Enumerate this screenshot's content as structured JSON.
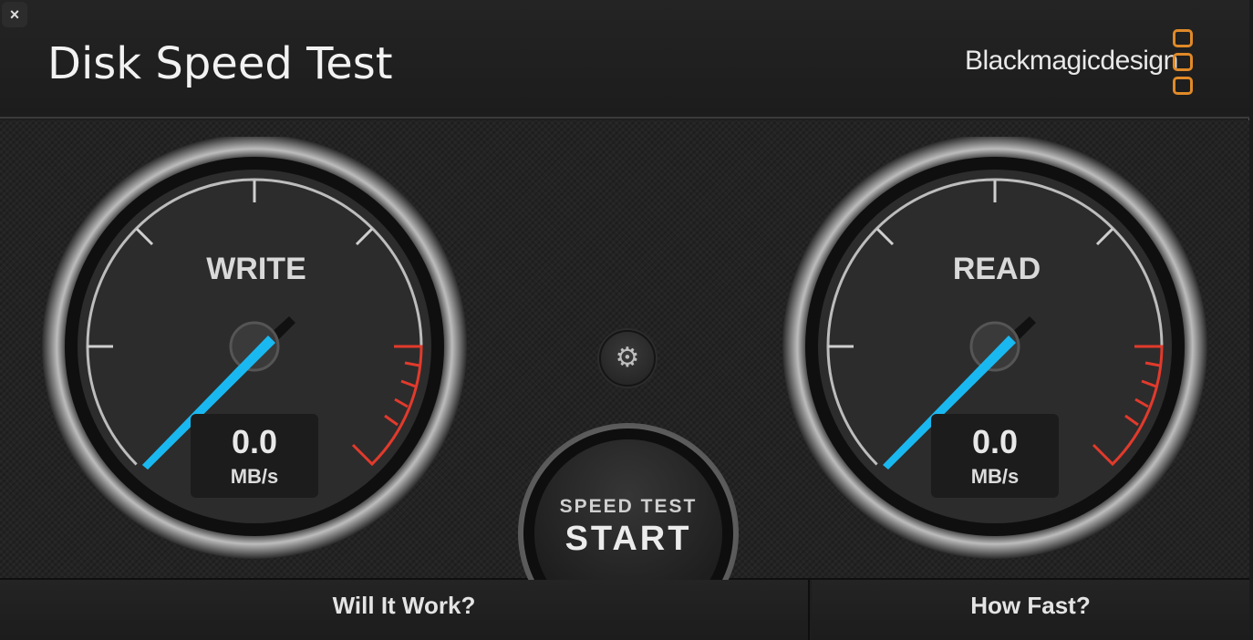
{
  "window": {
    "title": "Disk Speed Test",
    "close_label": "×",
    "brand_name": "Blackmagicdesign"
  },
  "gauges": {
    "write": {
      "label": "WRITE",
      "value": "0.0",
      "unit": "MB/s",
      "needle_color": "#1ab8f0",
      "redline_color": "#e23a2c"
    },
    "read": {
      "label": "READ",
      "value": "0.0",
      "unit": "MB/s",
      "needle_color": "#1ab8f0",
      "redline_color": "#e23a2c"
    }
  },
  "controls": {
    "settings_icon": "gear-icon",
    "start_top_label": "SPEED TEST",
    "start_main_label": "START"
  },
  "footer": {
    "will_it_work_label": "Will It Work?",
    "how_fast_label": "How Fast?"
  },
  "colors": {
    "brand_accent": "#e08a28",
    "needle": "#1ab8f0",
    "redline": "#e23a2c"
  }
}
